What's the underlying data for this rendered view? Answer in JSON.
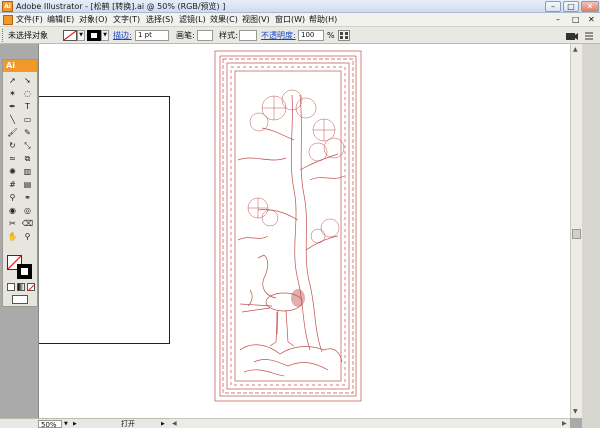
{
  "window": {
    "title": "Adobe Illustrator - [松鹤 [转换].ai @ 50% (RGB/预览) ]",
    "app_badge": "Ai",
    "minimize_glyph": "–",
    "maximize_glyph": "□",
    "close_glyph": "✕"
  },
  "menu": {
    "items": [
      "文件(F)",
      "编辑(E)",
      "对象(O)",
      "文字(T)",
      "选择(S)",
      "滤镜(L)",
      "效果(C)",
      "视图(V)",
      "窗口(W)",
      "帮助(H)"
    ],
    "doc_min": "–",
    "doc_max": "□",
    "doc_close": "✕"
  },
  "control": {
    "selection_status": "未选择对象",
    "stroke_label": "描边:",
    "stroke_weight": "1 pt",
    "brush_label": "画笔:",
    "style_label": "样式:",
    "opacity_label": "不透明度:",
    "opacity_value": "100",
    "percent": "%"
  },
  "tools": {
    "panel_badge": "Ai",
    "icons": [
      "selection-icon",
      "direct-selection-icon",
      "magic-wand-icon",
      "lasso-icon",
      "pen-icon",
      "type-icon",
      "line-segment-icon",
      "rectangle-icon",
      "paintbrush-icon",
      "pencil-icon",
      "rotate-icon",
      "scale-icon",
      "warp-icon",
      "free-transform-icon",
      "symbol-sprayer-icon",
      "column-graph-icon",
      "mesh-icon",
      "gradient-icon",
      "eyedropper-icon",
      "blend-icon",
      "live-paint-icon",
      "live-paint-selection-icon",
      "slice-icon",
      "eraser-icon",
      "hand-icon",
      "zoom-icon"
    ]
  },
  "status": {
    "zoom": "50%",
    "info": "打开"
  },
  "colors": {
    "accent": "#f19a2b",
    "artwork_stroke": "#c0504d"
  }
}
